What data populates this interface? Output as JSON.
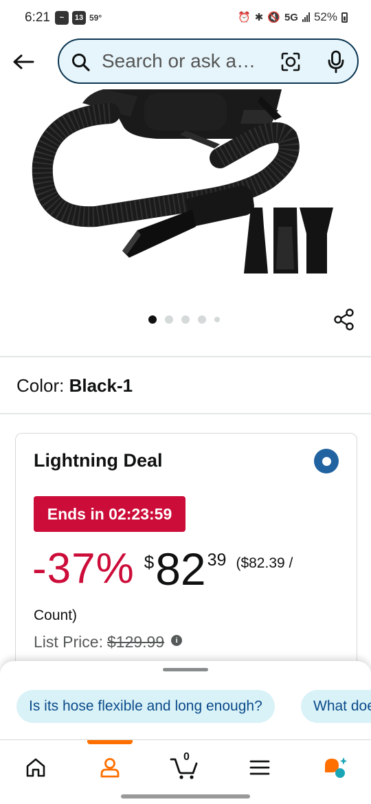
{
  "status_bar": {
    "time": "6:21",
    "temperature": "59°",
    "network": "5G",
    "battery": "52%"
  },
  "search": {
    "placeholder": "Search or ask a…"
  },
  "gallery": {
    "dot_count": 5,
    "active_index": 0
  },
  "variant": {
    "label": "Color:",
    "value": "Black-1"
  },
  "deal": {
    "title": "Lightning Deal",
    "ends_text": "Ends in 02:23:59",
    "discount": "-37%",
    "price_symbol": "$",
    "price_whole": "82",
    "price_fraction": "39",
    "unit_price_part1": "($82.39 /",
    "unit_price_part2": "Count)",
    "list_price_label": "List Price:",
    "list_price_value": "$129.99"
  },
  "suggestions": [
    "Is its hose flexible and long enough?",
    "What does it come with?"
  ],
  "bottom_nav": {
    "cart_count": "0",
    "active": "account"
  },
  "colors": {
    "accent_red": "#cc0c39",
    "link_blue": "#0b4a8a",
    "nav_active": "#ff6f00",
    "search_border": "#0b3550"
  }
}
